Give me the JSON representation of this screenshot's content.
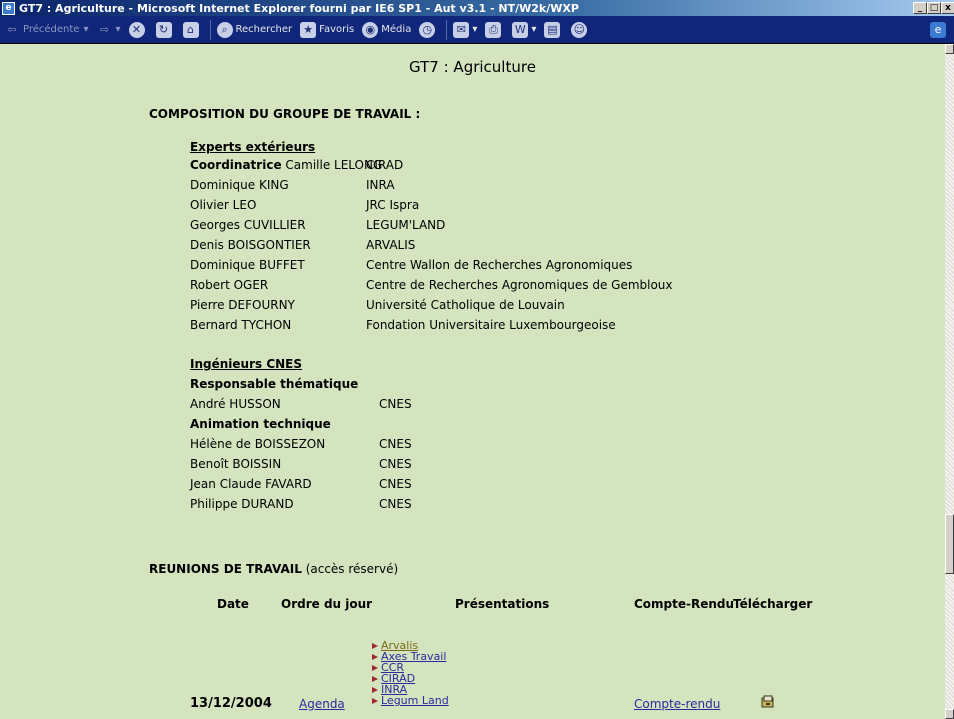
{
  "window": {
    "title": "GT7 : Agriculture - Microsoft Internet Explorer fourni par IE6 SP1 - Aut v3.1 - NT/W2k/WXP",
    "controls": [
      "_",
      "□",
      "x"
    ]
  },
  "toolbar": {
    "back_label": "Précédente",
    "search_label": "Rechercher",
    "favorites_label": "Favoris",
    "media_label": "Média"
  },
  "page": {
    "title": "GT7 : Agriculture",
    "composition_heading": "COMPOSITION DU GROUPE DE TRAVAIL :",
    "experts": {
      "heading": "Experts extérieurs",
      "coordinator_role": "Coordinatrice",
      "coordinator_name": "Camille LELONG",
      "coordinator_org": "CIRAD",
      "members": [
        {
          "name": "Dominique KING",
          "org": "INRA"
        },
        {
          "name": "Olivier LEO",
          "org": "JRC Ispra"
        },
        {
          "name": "Georges CUVILLIER",
          "org": "LEGUM'LAND"
        },
        {
          "name": "Denis BOISGONTIER",
          "org": "ARVALIS"
        },
        {
          "name": "Dominique BUFFET",
          "org": "Centre Wallon de Recherches Agronomiques"
        },
        {
          "name": "Robert OGER",
          "org": "Centre de Recherches Agronomiques de Gembloux"
        },
        {
          "name": "Pierre DEFOURNY",
          "org": "Université Catholique de Louvain"
        },
        {
          "name": "Bernard TYCHON",
          "org": "Fondation Universitaire Luxembourgeoise"
        }
      ]
    },
    "cnes": {
      "heading": "Ingénieurs CNES",
      "role_thematic": "Responsable thématique",
      "thematic": [
        {
          "name": "André HUSSON",
          "org": "CNES"
        }
      ],
      "role_technical": "Animation technique",
      "technical": [
        {
          "name": "Hélène de BOISSEZON",
          "org": "CNES"
        },
        {
          "name": "Benoît BOISSIN",
          "org": "CNES"
        },
        {
          "name": "Jean Claude FAVARD",
          "org": "CNES"
        },
        {
          "name": "Philippe DURAND",
          "org": "CNES"
        }
      ]
    },
    "meetings": {
      "heading": "REUNIONS DE TRAVAIL",
      "heading_note": "(accès réservé)",
      "columns": [
        "Date",
        "Ordre du jour",
        "Présentations",
        "Compte-Rendu",
        "Télécharger"
      ],
      "rows": [
        {
          "date": "13/12/2004",
          "agenda": "Agenda",
          "presentations": [
            "Arvalis",
            "Axes Travail",
            "CCR",
            "CIRAD",
            "INRA",
            "Legum Land"
          ],
          "report": "Compte-rendu",
          "download_icon": "download-icon"
        }
      ]
    }
  }
}
